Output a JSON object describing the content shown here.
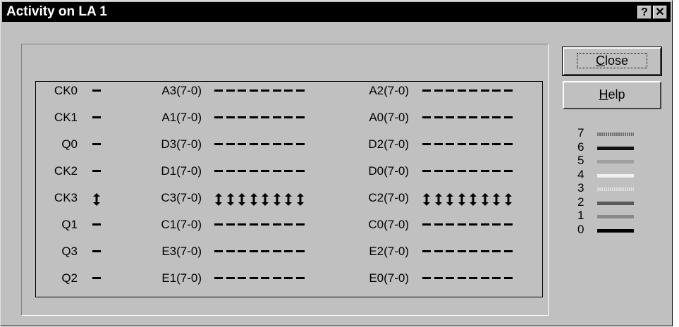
{
  "window": {
    "title": "Activity on LA 1"
  },
  "titlebar": {
    "help_glyph": "?",
    "close_glyph": "✕"
  },
  "buttons": {
    "close": {
      "label_pre": "",
      "mnemonic": "C",
      "label_post": "lose"
    },
    "help": {
      "label_pre": "",
      "mnemonic": "H",
      "label_post": "elp"
    }
  },
  "signal_columns": [
    [
      {
        "label": "CK0",
        "activity": [
          "low"
        ]
      },
      {
        "label": "CK1",
        "activity": [
          "low"
        ]
      },
      {
        "label": "Q0",
        "activity": [
          "low"
        ]
      },
      {
        "label": "CK2",
        "activity": [
          "low"
        ]
      },
      {
        "label": "CK3",
        "activity": [
          "toggle"
        ]
      },
      {
        "label": "Q1",
        "activity": [
          "low"
        ]
      },
      {
        "label": "Q3",
        "activity": [
          "low"
        ]
      },
      {
        "label": "Q2",
        "activity": [
          "low"
        ]
      }
    ],
    [
      {
        "label": "A3(7-0)",
        "activity": [
          "low",
          "low",
          "low",
          "low",
          "low",
          "low",
          "low",
          "low"
        ]
      },
      {
        "label": "A1(7-0)",
        "activity": [
          "low",
          "low",
          "low",
          "low",
          "low",
          "low",
          "low",
          "low"
        ]
      },
      {
        "label": "D3(7-0)",
        "activity": [
          "low",
          "low",
          "low",
          "low",
          "low",
          "low",
          "low",
          "low"
        ]
      },
      {
        "label": "D1(7-0)",
        "activity": [
          "low",
          "low",
          "low",
          "low",
          "low",
          "low",
          "low",
          "low"
        ]
      },
      {
        "label": "C3(7-0)",
        "activity": [
          "toggle",
          "toggle",
          "toggle",
          "toggle",
          "toggle",
          "toggle",
          "toggle",
          "toggle"
        ]
      },
      {
        "label": "C1(7-0)",
        "activity": [
          "low",
          "low",
          "low",
          "low",
          "low",
          "low",
          "low",
          "low"
        ]
      },
      {
        "label": "E3(7-0)",
        "activity": [
          "low",
          "low",
          "low",
          "low",
          "low",
          "low",
          "low",
          "low"
        ]
      },
      {
        "label": "E1(7-0)",
        "activity": [
          "low",
          "low",
          "low",
          "low",
          "low",
          "low",
          "low",
          "low"
        ]
      }
    ],
    [
      {
        "label": "A2(7-0)",
        "activity": [
          "low",
          "low",
          "low",
          "low",
          "low",
          "low",
          "low",
          "low"
        ]
      },
      {
        "label": "A0(7-0)",
        "activity": [
          "low",
          "low",
          "low",
          "low",
          "low",
          "low",
          "low",
          "low"
        ]
      },
      {
        "label": "D2(7-0)",
        "activity": [
          "low",
          "low",
          "low",
          "low",
          "low",
          "low",
          "low",
          "low"
        ]
      },
      {
        "label": "D0(7-0)",
        "activity": [
          "low",
          "low",
          "low",
          "low",
          "low",
          "low",
          "low",
          "low"
        ]
      },
      {
        "label": "C2(7-0)",
        "activity": [
          "toggle",
          "toggle",
          "toggle",
          "toggle",
          "toggle",
          "toggle",
          "toggle",
          "toggle"
        ]
      },
      {
        "label": "C0(7-0)",
        "activity": [
          "low",
          "low",
          "low",
          "low",
          "low",
          "low",
          "low",
          "low"
        ]
      },
      {
        "label": "E2(7-0)",
        "activity": [
          "low",
          "low",
          "low",
          "low",
          "low",
          "low",
          "low",
          "low"
        ]
      },
      {
        "label": "E0(7-0)",
        "activity": [
          "low",
          "low",
          "low",
          "low",
          "low",
          "low",
          "low",
          "low"
        ]
      }
    ]
  ],
  "legend": [
    {
      "label": "7",
      "color": "#6f6f6f",
      "pattern": "hatched"
    },
    {
      "label": "6",
      "color": "#111111",
      "pattern": "solid"
    },
    {
      "label": "5",
      "color": "#a0a0a0",
      "pattern": "solid"
    },
    {
      "label": "4",
      "color": "#f0f0f0",
      "pattern": "solid"
    },
    {
      "label": "3",
      "color": "#dddddd",
      "pattern": "hatched"
    },
    {
      "label": "2",
      "color": "#585858",
      "pattern": "solid"
    },
    {
      "label": "1",
      "color": "#888888",
      "pattern": "solid"
    },
    {
      "label": "0",
      "color": "#000000",
      "pattern": "solid"
    }
  ]
}
